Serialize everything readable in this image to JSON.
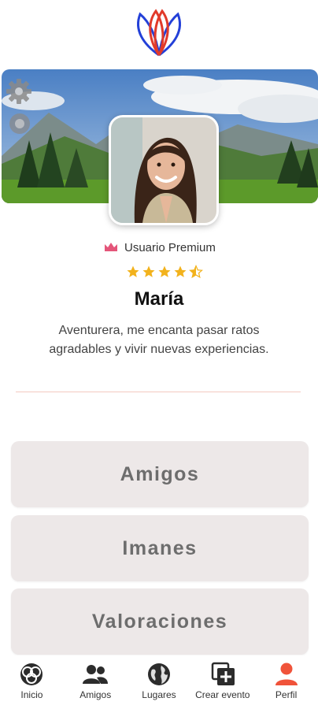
{
  "app": {
    "accent": "#f0533a",
    "brand_blue": "#2340d8",
    "brand_red": "#e13a2a"
  },
  "profile": {
    "badge": "Usuario Premium",
    "rating": 4.5,
    "name": "María",
    "bio": "Aventurera, me  encanta pasar ratos agradables y vivir nuevas experiencias."
  },
  "sections": [
    {
      "label": "Amigos"
    },
    {
      "label": "Imanes"
    },
    {
      "label": "Valoraciones"
    }
  ],
  "nav": [
    {
      "label": "Inicio",
      "icon": "home-icon"
    },
    {
      "label": "Amigos",
      "icon": "friends-icon"
    },
    {
      "label": "Lugares",
      "icon": "globe-icon"
    },
    {
      "label": "Crear evento",
      "icon": "add-event-icon"
    },
    {
      "label": "Perfil",
      "icon": "profile-icon",
      "active": true
    }
  ]
}
